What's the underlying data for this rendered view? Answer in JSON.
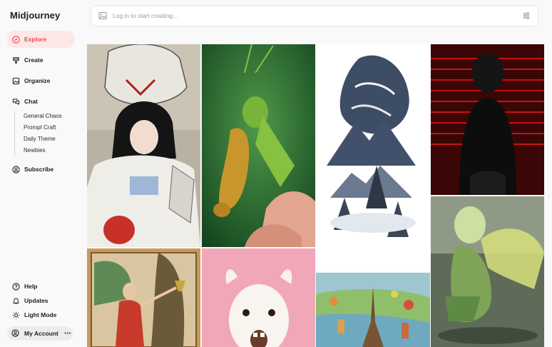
{
  "app": {
    "title": "Midjourney"
  },
  "nav": {
    "explore": "Explore",
    "create": "Create",
    "organize": "Organize",
    "chat": "Chat",
    "chat_channels": [
      "General Chaos",
      "Prompt Craft",
      "Daily Theme",
      "Newbies"
    ],
    "subscribe": "Subscribe"
  },
  "footer": {
    "help": "Help",
    "updates": "Updates",
    "light_mode": "Light Mode",
    "account": "My Account"
  },
  "prompt": {
    "placeholder": "Log in to start creating..."
  },
  "gallery": {
    "images": [
      "anime-girl-with-mecha-skull",
      "grasshopper-playing-saxophone",
      "tiger-ink-mountain-landscape",
      "figure-in-red-striped-light",
      "tarot-woman-with-chalice",
      "screaming-llama-pink-background",
      "miniature-eiffel-tower-city",
      "green-fairy-creature-in-pond"
    ]
  },
  "colors": {
    "accent": "#ef4444",
    "accent_bg": "#fde7e7"
  }
}
